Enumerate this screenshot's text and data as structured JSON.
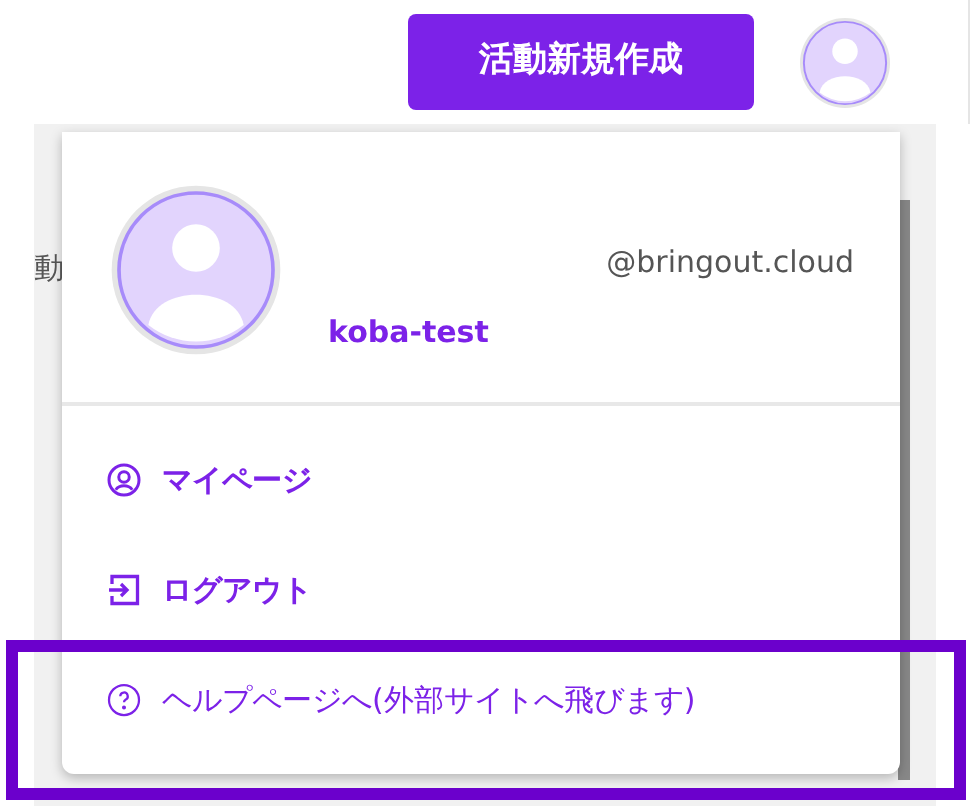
{
  "header": {
    "create_button": "活動新規作成"
  },
  "page": {
    "partial_text": "動"
  },
  "account_menu": {
    "email": "@bringout.cloud",
    "username": "koba-test",
    "items": [
      {
        "kind": "profile",
        "label": "マイページ"
      },
      {
        "kind": "logout",
        "label": "ログアウト"
      },
      {
        "kind": "help",
        "label": "ヘルプページへ(外部サイトへ飛びます)"
      }
    ]
  }
}
